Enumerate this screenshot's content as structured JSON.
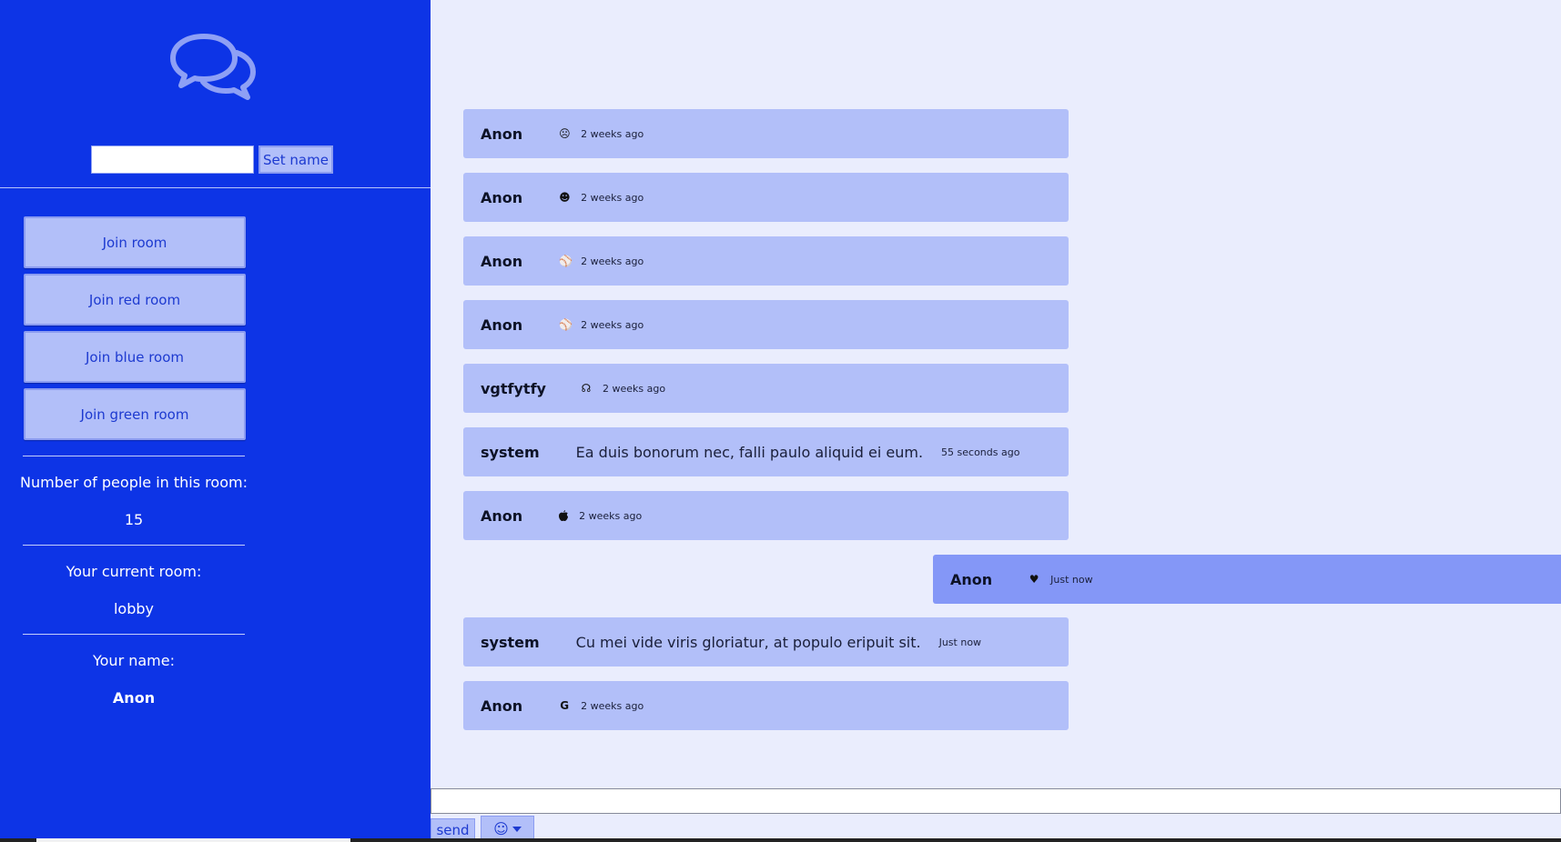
{
  "sidebar": {
    "logo_icon": "chat-bubbles-icon",
    "name_input": {
      "value": "",
      "placeholder": ""
    },
    "set_name_label": "Set name",
    "rooms": [
      {
        "label": "Join room"
      },
      {
        "label": "Join red room"
      },
      {
        "label": "Join blue room"
      },
      {
        "label": "Join green room"
      }
    ],
    "people_label": "Number of people in this room:",
    "people_count": "15",
    "current_room_label": "Your current room:",
    "current_room": "lobby",
    "your_name_label": "Your name:",
    "your_name": "Anon"
  },
  "messages": [
    {
      "author": "Anon",
      "icon": "☹",
      "text": "",
      "time": "2 weeks ago"
    },
    {
      "author": "Anon",
      "icon": "☻",
      "text": "",
      "time": "2 weeks ago"
    },
    {
      "author": "Anon",
      "icon": "⚾",
      "text": "",
      "time": "2 weeks ago"
    },
    {
      "author": "Anon",
      "icon": "⚾",
      "text": "",
      "time": "2 weeks ago"
    },
    {
      "author": "vgtfytfy",
      "icon": "☊",
      "text": "",
      "time": "2 weeks ago"
    },
    {
      "author": "system",
      "icon": "",
      "text": "Ea duis bonorum nec, falli paulo aliquid ei eum.",
      "time": "55 seconds ago"
    },
    {
      "author": "Anon",
      "icon": "",
      "text": "",
      "time": "2 weeks ago"
    },
    {
      "author": "Anon",
      "icon": "♥",
      "text": "",
      "time": "Just now"
    },
    {
      "author": "system",
      "icon": "",
      "text": "Cu mei vide viris gloriatur, at populo eripuit sit.",
      "time": "Just now"
    },
    {
      "author": "Anon",
      "icon": "G",
      "text": "",
      "time": "2 weeks ago"
    }
  ],
  "composer": {
    "input_value": "",
    "send_label": "send",
    "emoji_icon": "☺"
  },
  "colors": {
    "sidebar_bg": "#0d34e6",
    "chat_bg": "#eaedfd",
    "message_bg": "#b2bff9",
    "own_message_bg": "#8497f7",
    "button_text": "#1d3ad0"
  }
}
